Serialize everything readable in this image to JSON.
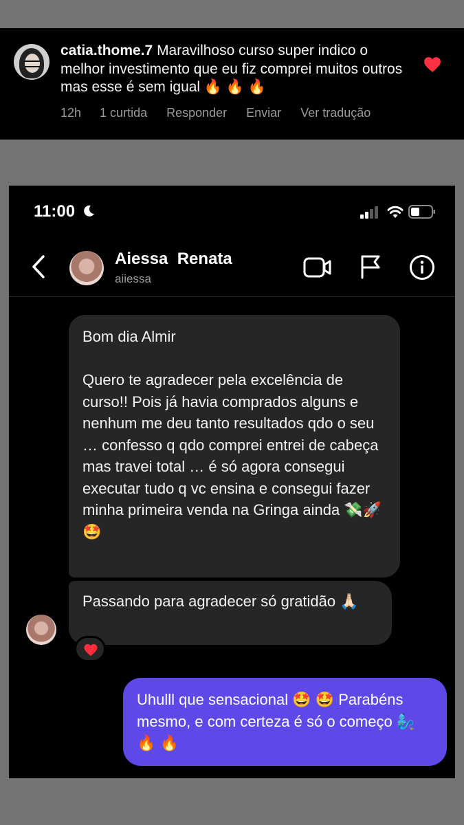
{
  "comment": {
    "username": "catia.thome.7",
    "text": "Maravilhoso curso super indico o melhor investimento que eu fiz comprei muitos outros mas esse é sem igual 🔥 🔥 🔥",
    "time": "12h",
    "likes": "1 curtida",
    "reply_label": "Responder",
    "send_label": "Enviar",
    "translate_label": "Ver tradução",
    "heart_color": "#ff3040"
  },
  "status_bar": {
    "time": "11:00"
  },
  "header": {
    "name": "Aiessa  Renata",
    "handle": "aiiessa"
  },
  "messages": [
    {
      "sender": "them",
      "lines_top": "Bom dia Almir",
      "body": "Quero te agradecer pela excelência de curso!! Pois já havia comprados alguns e nenhum me deu tanto resultados qdo o seu … confesso q qdo comprei entrei de cabeça mas travei total … é só agora consegui executar tudo q vc ensina e consegui fazer minha primeira venda na Gringa ainda 💸🚀 🤩"
    },
    {
      "sender": "them",
      "text": "Passando para agradecer só gratidão 🙏🏻",
      "reaction": "❤️"
    },
    {
      "sender": "me",
      "text": "Uhulll que sensacional 🤩 🤩 Parabéns mesmo, e com certeza é só o começo 🧞‍♂️ 🔥 🔥",
      "bubble_color": "#5e48e8"
    }
  ],
  "colors": {
    "outer_background": "#737373",
    "card_background": "#000000",
    "incoming_bubble": "#262626",
    "secondary_text": "#9a9a9a"
  }
}
